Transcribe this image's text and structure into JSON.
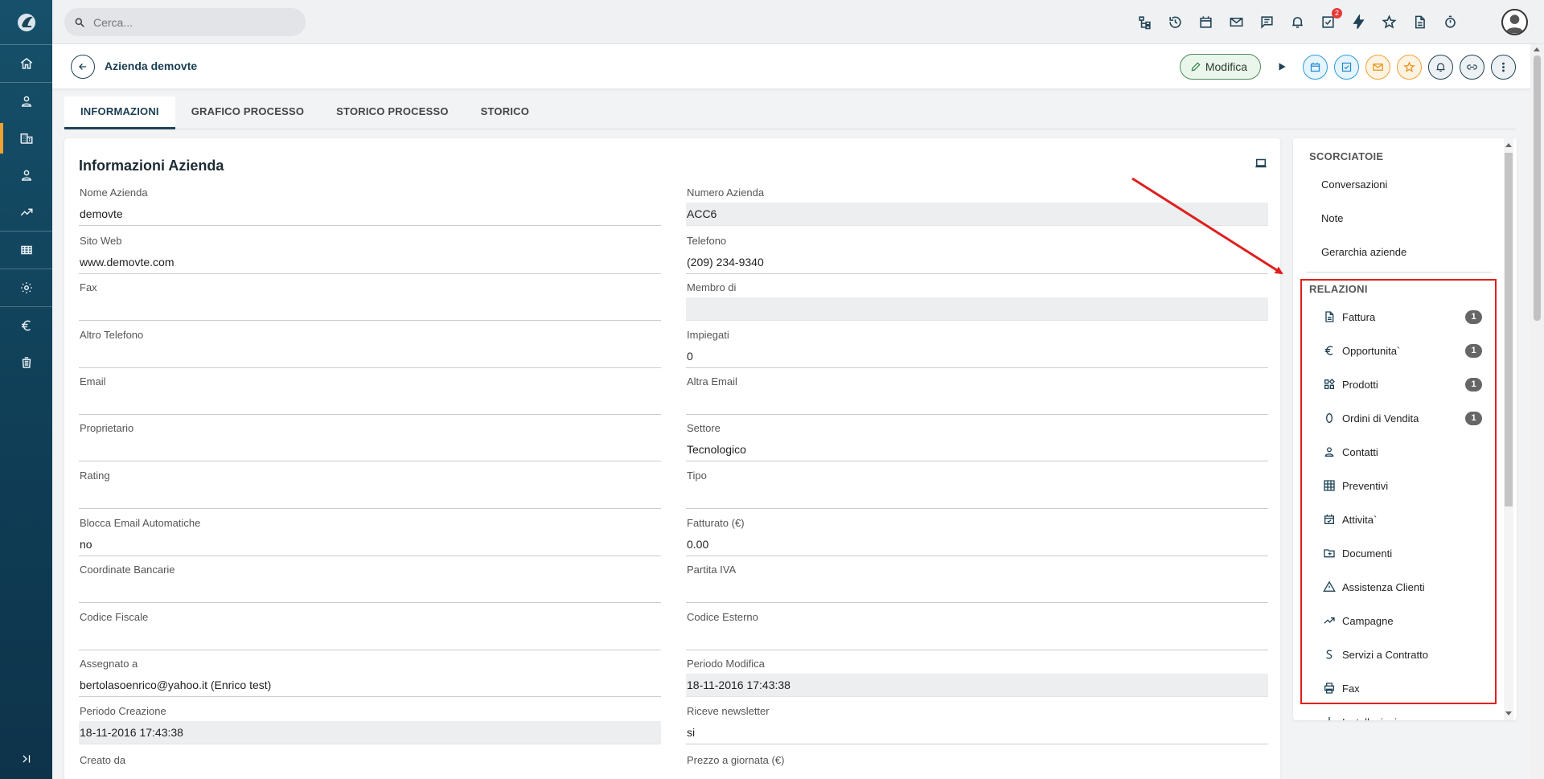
{
  "search": {
    "placeholder": "Cerca..."
  },
  "notifications": {
    "tasks_count": "2"
  },
  "record": {
    "title": "Azienda demovte",
    "edit_label": "Modifica"
  },
  "tabs": [
    {
      "label": "INFORMAZIONI"
    },
    {
      "label": "GRAFICO PROCESSO"
    },
    {
      "label": "STORICO PROCESSO"
    },
    {
      "label": "STORICO"
    }
  ],
  "section": {
    "title": "Informazioni Azienda"
  },
  "fields": [
    {
      "label": "Nome Azienda",
      "value": "demovte",
      "readonly": false
    },
    {
      "label": "Numero Azienda",
      "value": "ACC6",
      "readonly": true
    },
    {
      "label": "Sito Web",
      "value": "www.demovte.com",
      "readonly": false
    },
    {
      "label": "Telefono",
      "value": "(209) 234-9340",
      "readonly": false
    },
    {
      "label": "Fax",
      "value": "",
      "readonly": false
    },
    {
      "label": "Membro di",
      "value": "",
      "readonly": true
    },
    {
      "label": "Altro Telefono",
      "value": "",
      "readonly": false
    },
    {
      "label": "Impiegati",
      "value": "0",
      "readonly": false
    },
    {
      "label": "Email",
      "value": "",
      "readonly": false
    },
    {
      "label": "Altra Email",
      "value": "",
      "readonly": false
    },
    {
      "label": "Proprietario",
      "value": "",
      "readonly": false
    },
    {
      "label": "Settore",
      "value": "Tecnologico",
      "readonly": false
    },
    {
      "label": "Rating",
      "value": "",
      "readonly": false
    },
    {
      "label": "Tipo",
      "value": "",
      "readonly": false
    },
    {
      "label": "Blocca Email Automatiche",
      "value": "no",
      "readonly": false
    },
    {
      "label": "Fatturato (€)",
      "value": "0.00",
      "readonly": false
    },
    {
      "label": "Coordinate Bancarie",
      "value": "",
      "readonly": false
    },
    {
      "label": "Partita IVA",
      "value": "",
      "readonly": false
    },
    {
      "label": "Codice Fiscale",
      "value": "",
      "readonly": false
    },
    {
      "label": "Codice Esterno",
      "value": "",
      "readonly": false
    },
    {
      "label": "Assegnato a",
      "value": "bertolasoenrico@yahoo.it (Enrico test)",
      "readonly": false
    },
    {
      "label": "Periodo Modifica",
      "value": "18-11-2016 17:43:38",
      "readonly": true
    },
    {
      "label": "Periodo Creazione",
      "value": "18-11-2016 17:43:38",
      "readonly": true
    },
    {
      "label": "Riceve newsletter",
      "value": "si",
      "readonly": false
    },
    {
      "label": "Creato da",
      "value": "",
      "readonly": false
    },
    {
      "label": "Prezzo a giornata (€)",
      "value": "",
      "readonly": false
    }
  ],
  "shortcuts": {
    "heading": "SCORCIATOIE",
    "items": [
      {
        "label": "Conversazioni"
      },
      {
        "label": "Note"
      },
      {
        "label": "Gerarchia aziende"
      }
    ]
  },
  "relations": {
    "heading": "RELAZIONI",
    "items": [
      {
        "label": "Fattura",
        "icon": "document-icon",
        "count": "1"
      },
      {
        "label": "Opportunita`",
        "icon": "euro-icon",
        "count": "1"
      },
      {
        "label": "Prodotti",
        "icon": "widgets-icon",
        "count": "1"
      },
      {
        "label": "Ordini di Vendita",
        "icon": "zero-icon",
        "count": "1"
      },
      {
        "label": "Contatti",
        "icon": "person-icon",
        "count": ""
      },
      {
        "label": "Preventivi",
        "icon": "calculator-icon",
        "count": ""
      },
      {
        "label": "Attivita`",
        "icon": "calendar-check-icon",
        "count": ""
      },
      {
        "label": "Documenti",
        "icon": "folder-icon",
        "count": ""
      },
      {
        "label": "Assistenza Clienti",
        "icon": "warning-icon",
        "count": ""
      },
      {
        "label": "Campagne",
        "icon": "trending-up-icon",
        "count": ""
      },
      {
        "label": "Servizi a Contratto",
        "icon": "s-letter-icon",
        "count": ""
      },
      {
        "label": "Fax",
        "icon": "printer-icon",
        "count": ""
      },
      {
        "label": "Installazioni",
        "icon": "wrench-icon",
        "count": ""
      }
    ]
  },
  "colors": {
    "annotation": "#e01e1e",
    "accent": "#f0a232",
    "primary": "#1f4356"
  }
}
